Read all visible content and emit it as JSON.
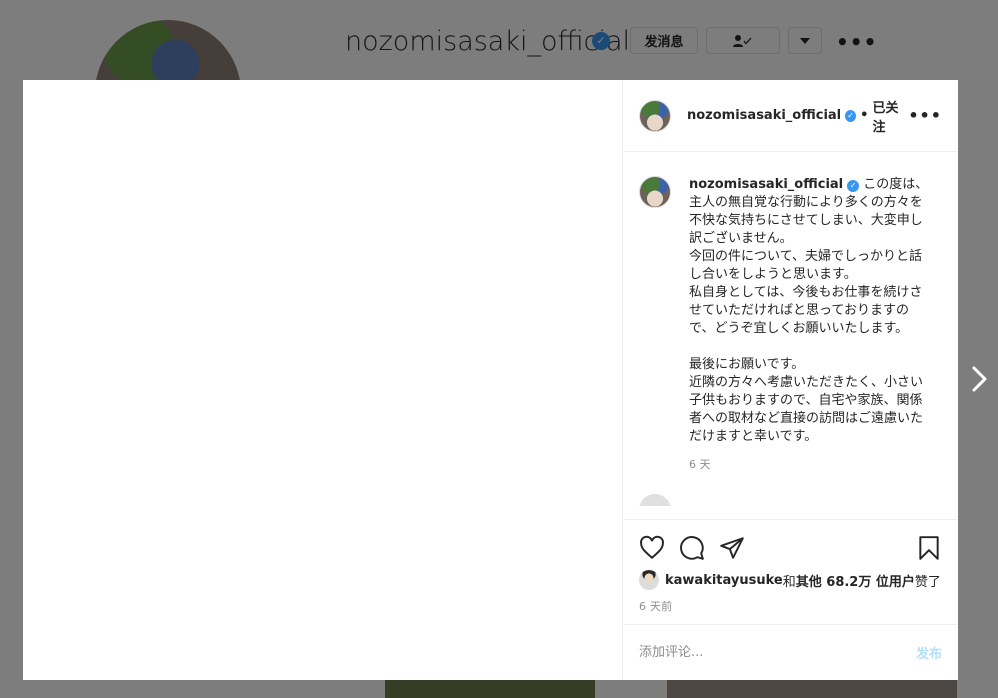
{
  "background": {
    "username": "nozomisasaki_official",
    "message_button": "发消息",
    "follow_button_icon": "person-check-icon",
    "dropdown_icon": "caret-down-icon",
    "more_icon": "more-horizontal-icon"
  },
  "modal": {
    "header": {
      "username": "nozomisasaki_official",
      "separator": "•",
      "follow_state": "已关注",
      "more": "•••"
    },
    "caption": {
      "username": "nozomisasaki_official",
      "text": "この度は、主人の無自覚な行動により多くの方々を不快な気持ちにさせてしまい、大変申し訳ございません。\n今回の件について、夫婦でしっかりと話し合いをしようと思います。\n私自身としては、今後もお仕事を続けさせていただければと思っておりますので、どうぞ宜しくお願いいたします。\n\n最後にお願いです。\n近隣の方々へ考慮いただきたく、小さい子供もおりますので、自宅や家族、関係者への取材など直接の訪問はご遠慮いただけますと幸いです。",
      "time": "6 天"
    },
    "next_comment_preview": "",
    "actions": {
      "like_icon": "heart-icon",
      "comment_icon": "comment-icon",
      "share_icon": "send-icon",
      "save_icon": "bookmark-icon"
    },
    "likes": {
      "user": "kawakitayusuke",
      "and": " 和 ",
      "others": "其他 68.2万 位用户",
      "suffix": " 赞了"
    },
    "post_time": "6 天前",
    "comment_input": {
      "placeholder": "添加评论..."
    },
    "post_button": "发布"
  },
  "nav": {
    "next_icon": "chevron-right-icon"
  },
  "colors": {
    "verified": "#3897f0",
    "post_button_disabled": "#b2dffc",
    "overlay": "rgba(0,0,0,0.5)"
  }
}
